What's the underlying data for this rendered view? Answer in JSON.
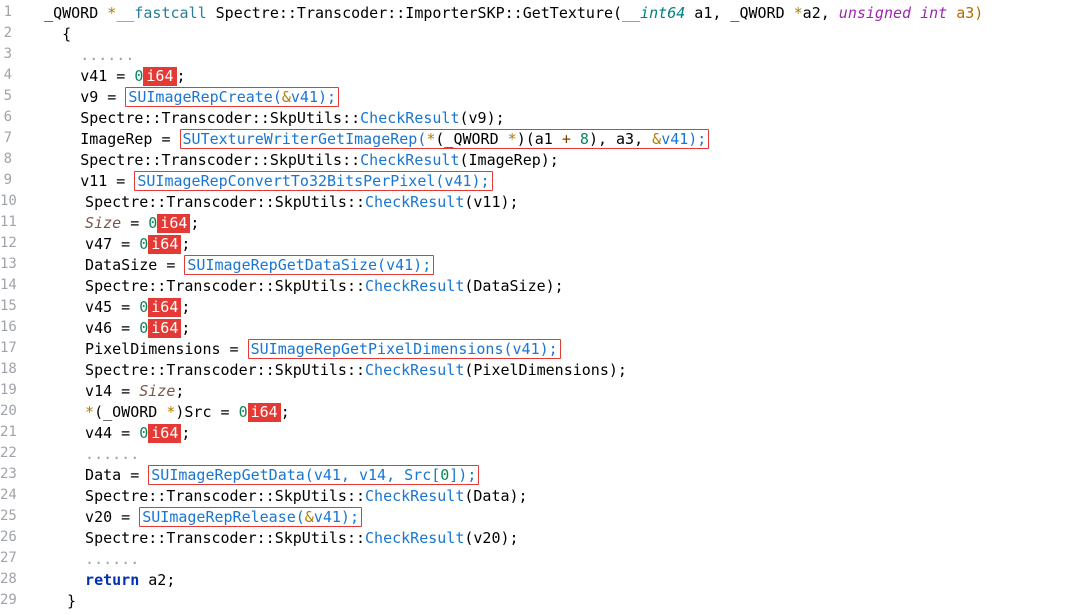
{
  "lines": {
    "l1": {
      "ret": "_QWORD ",
      "star": "*",
      "cc": "__fastcall ",
      "ns": "Spectre::Transcoder::ImporterSKP::GetTexture",
      "p1t": "__int64",
      "p1n": " a1, ",
      "p2t": "_QWORD ",
      "p2star": "*",
      "p2n": "a2, ",
      "p3t": "unsigned int",
      "p3n": " a3)"
    },
    "l2": {
      "brace": "{"
    },
    "l3": {
      "dots": "......"
    },
    "l4": {
      "lhs": "v41 = ",
      "zero": "0",
      "i64": "i64",
      "semi": ";"
    },
    "l5": {
      "lhs": "v9 = ",
      "call": "SUImageRepCreate(",
      "amp": "&",
      "arg": "v41);"
    },
    "l6": {
      "ns": "Spectre::Transcoder::SkpUtils::",
      "fn": "CheckResult",
      "rest": "(v9);"
    },
    "l7": {
      "lhs": "ImageRep = ",
      "call": "SUTextureWriterGetImageRep(",
      "star": "*",
      "cast": "(_QWORD ",
      "star2": "*",
      "castend": ")(a1 ",
      "plus": "+",
      "eight": " 8",
      "paren2": "), a3, ",
      "amp": "&",
      "tail": "v41);"
    },
    "l8": {
      "ns": "Spectre::Transcoder::SkpUtils::",
      "fn": "CheckResult",
      "rest": "(ImageRep);"
    },
    "l9": {
      "lhs": "v11 = ",
      "call": "SUImageRepConvertTo32BitsPerPixel(v41);"
    },
    "l10": {
      "ns": "Spectre::Transcoder::SkpUtils::",
      "fn": "CheckResult",
      "rest": "(v11);"
    },
    "l11": {
      "lhs": "Size",
      "eq": " = ",
      "zero": "0",
      "i64": "i64",
      "semi": ";"
    },
    "l12": {
      "lhs": "v47 = ",
      "zero": "0",
      "i64": "i64",
      "semi": ";"
    },
    "l13": {
      "lhs": "DataSize = ",
      "call": "SUImageRepGetDataSize(v41);"
    },
    "l14": {
      "ns": "Spectre::Transcoder::SkpUtils::",
      "fn": "CheckResult",
      "rest": "(DataSize);"
    },
    "l15": {
      "lhs": "v45 = ",
      "zero": "0",
      "i64": "i64",
      "semi": ";"
    },
    "l16": {
      "lhs": "v46 = ",
      "zero": "0",
      "i64": "i64",
      "semi": ";"
    },
    "l17": {
      "lhs": "PixelDimensions = ",
      "call": "SUImageRepGetPixelDimensions(v41);"
    },
    "l18": {
      "ns": "Spectre::Transcoder::SkpUtils::",
      "fn": "CheckResult",
      "rest": "(PixelDimensions);"
    },
    "l19": {
      "lhs": "v14 = ",
      "rhs": "Size",
      "semi": ";"
    },
    "l20": {
      "star": "*",
      "cast": "(_OWORD ",
      "star2": "*",
      "castend": ")Src = ",
      "zero": "0",
      "i64": "i64",
      "semi": ";"
    },
    "l21": {
      "lhs": "v44 = ",
      "zero": "0",
      "i64": "i64",
      "semi": ";"
    },
    "l22": {
      "dots": "......"
    },
    "l23": {
      "lhs": "Data = ",
      "call": "SUImageRepGetData(v41, v14, Src[",
      "idx": "0",
      "tail": "]);"
    },
    "l24": {
      "ns": "Spectre::Transcoder::SkpUtils::",
      "fn": "CheckResult",
      "rest": "(Data);"
    },
    "l25": {
      "lhs": "v20 = ",
      "call": "SUImageRepRelease(",
      "amp": "&",
      "arg": "v41);"
    },
    "l26": {
      "ns": "Spectre::Transcoder::SkpUtils::",
      "fn": "CheckResult",
      "rest": "(v20);"
    },
    "l27": {
      "dots": "......"
    },
    "l28": {
      "kw": "return",
      "rest": " a2;"
    },
    "l29": {
      "brace": "}"
    }
  },
  "linenums": [
    "1",
    "2",
    "3",
    "4",
    "5",
    "6",
    "7",
    "8",
    "9",
    "10",
    "11",
    "12",
    "13",
    "14",
    "15",
    "16",
    "17",
    "18",
    "19",
    "20",
    "21",
    "22",
    "23",
    "24",
    "25",
    "26",
    "27",
    "28",
    "29"
  ]
}
